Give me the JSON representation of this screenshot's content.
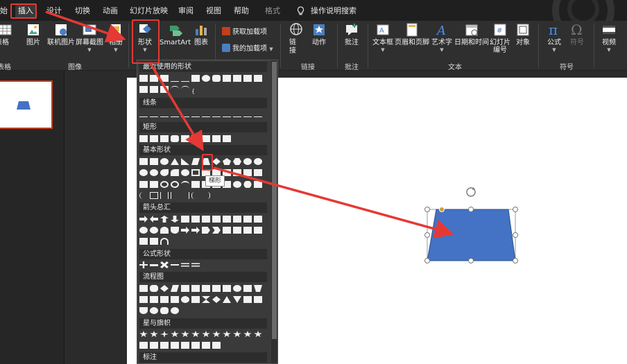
{
  "tabs": [
    {
      "label": "始",
      "active": false
    },
    {
      "label": "插入",
      "active": true
    },
    {
      "label": "设计",
      "active": false
    },
    {
      "label": "切换",
      "active": false
    },
    {
      "label": "动画",
      "active": false
    },
    {
      "label": "幻灯片放映",
      "active": false
    },
    {
      "label": "审阅",
      "active": false
    },
    {
      "label": "视图",
      "active": false
    },
    {
      "label": "帮助",
      "active": false
    },
    {
      "label": "格式",
      "active": false,
      "contextual": true
    }
  ],
  "tellme": "操作说明搜索",
  "ribbon": {
    "table": "表格",
    "image": "图片",
    "online_image": "联机图片",
    "screenshot": "屏幕截图",
    "album": "相册",
    "shapes": "形状",
    "smartart": "SmartArt",
    "chart": "图表",
    "get_addins": "获取加载项",
    "my_addins": "我的加载项",
    "link": "链接",
    "action": "动作",
    "comment": "批注",
    "textbox": "文本框",
    "header_footer": "页眉和页脚",
    "wordart": "艺术字",
    "datetime": "日期和时间",
    "slide_number": "幻灯片编号",
    "object": "对象",
    "equation": "公式",
    "symbol": "符号",
    "video": "视频",
    "groups": {
      "table": "表格",
      "images": "图像",
      "links": "链接",
      "comments": "批注",
      "text": "文本",
      "symbols": "符号"
    }
  },
  "gallery": {
    "sections": [
      "最近使用的形状",
      "线条",
      "矩形",
      "基本形状",
      "箭头总汇",
      "公式形状",
      "流程图",
      "星与旗帜",
      "标注"
    ],
    "tooltip": "梯形"
  },
  "colors": {
    "accent": "#c43e1c",
    "shape_fill": "#4472c4",
    "shape_stroke": "#2f528f",
    "highlight": "#e53935",
    "handle": "#d19b3a"
  }
}
